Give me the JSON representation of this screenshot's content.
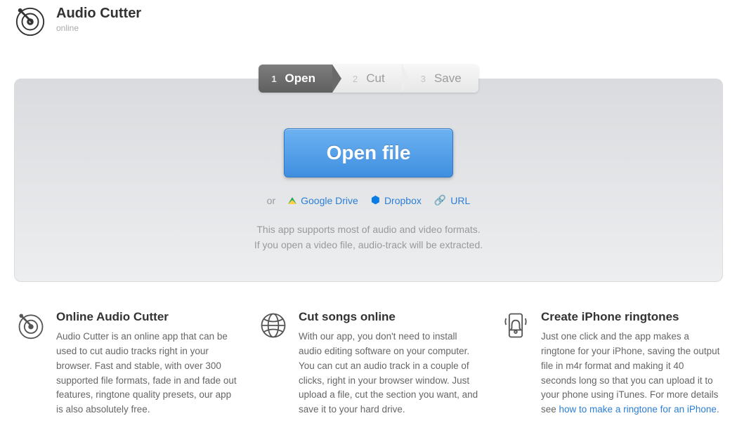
{
  "header": {
    "title": "Audio Cutter",
    "subtitle": "online"
  },
  "steps": [
    {
      "num": "1",
      "label": "Open",
      "active": true
    },
    {
      "num": "2",
      "label": "Cut",
      "active": false
    },
    {
      "num": "3",
      "label": "Save",
      "active": false
    }
  ],
  "panel": {
    "open_button": "Open file",
    "or_label": "or",
    "google_drive": "Google Drive",
    "dropbox": "Dropbox",
    "url": "URL",
    "hint_line1": "This app supports most of audio and video formats.",
    "hint_line2": "If you open a video file, audio-track will be extracted."
  },
  "features": [
    {
      "title": "Online Audio Cutter",
      "body": "Audio Cutter is an online app that can be used to cut audio tracks right in your browser. Fast and stable, with over 300 supported file formats, fade in and fade out features, ringtone quality presets, our app is also absolutely free.",
      "link": ""
    },
    {
      "title": "Cut songs online",
      "body": "With our app, you don't need to install audio editing software on your computer. You can cut an audio track in a couple of clicks, right in your browser window. Just upload a file, cut the section you want, and save it to your hard drive.",
      "link": ""
    },
    {
      "title": "Create iPhone ringtones",
      "body": "Just one click and the app makes a ringtone for your iPhone, saving the output file in m4r format and making it 40 seconds long so that you can upload it to your phone using iTunes. For more details see ",
      "link": "how to make a ringtone for an iPhone"
    }
  ]
}
